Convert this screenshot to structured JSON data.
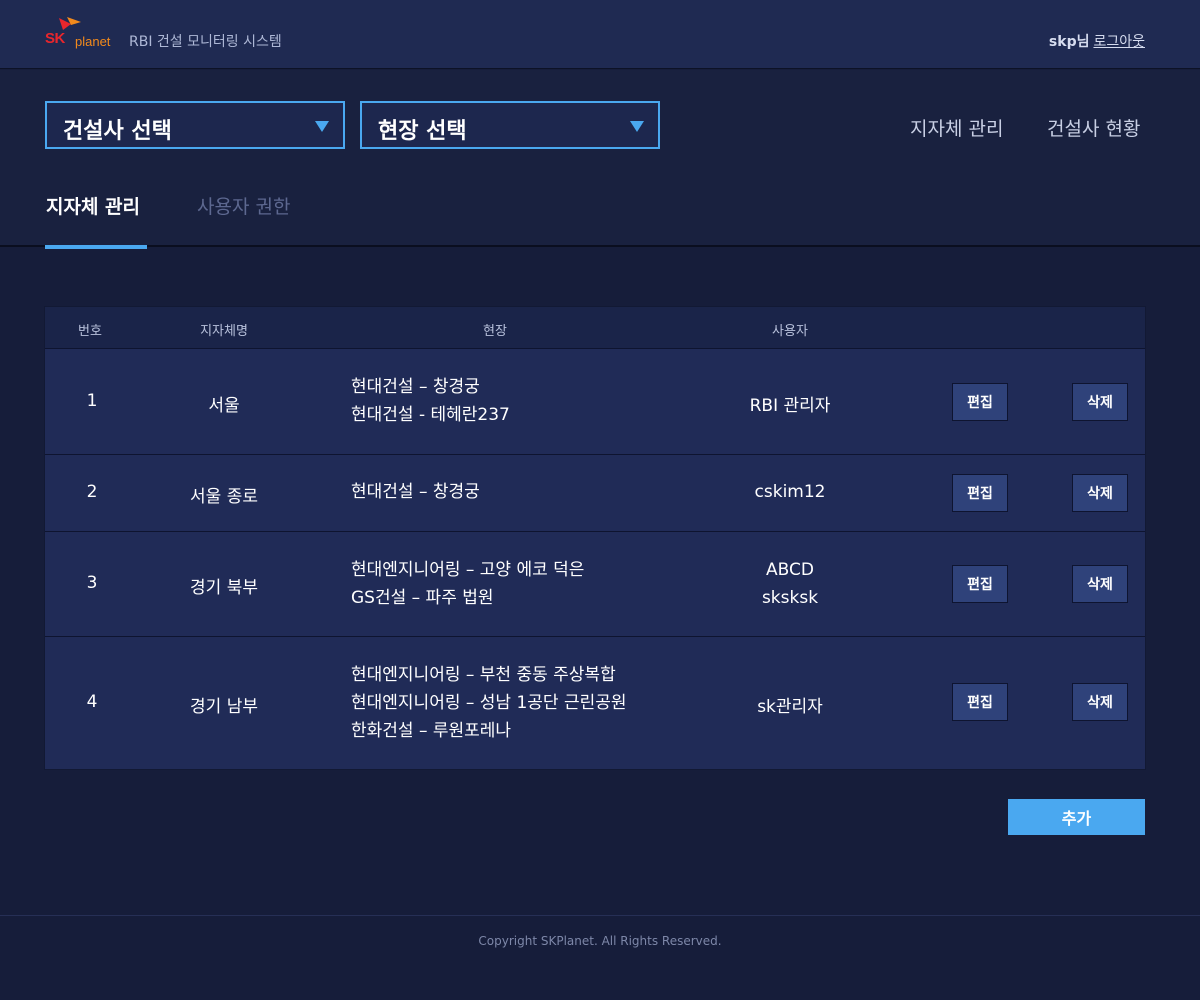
{
  "header": {
    "logo_sk": "SK",
    "logo_planet": "planet",
    "app_title": "RBI 건설 모니터링 시스템",
    "user_name": "skp님",
    "logout_label": "로그아웃"
  },
  "selectors": {
    "company_label": "건설사 선택",
    "site_label": "현장 선택"
  },
  "topnav": {
    "items": [
      "지자체 관리",
      "건설사 현황"
    ]
  },
  "tabs": [
    {
      "label": "지자체 관리",
      "active": true
    },
    {
      "label": "사용자 권한",
      "active": false
    }
  ],
  "table": {
    "headers": [
      "번호",
      "지자체명",
      "현장",
      "사용자"
    ],
    "rows": [
      {
        "no": "1",
        "region": "서울",
        "sites": [
          "현대건설 – 창경궁",
          "현대건설 - 테헤란237"
        ],
        "users": [
          "RBI 관리자"
        ]
      },
      {
        "no": "2",
        "region": "서울 종로",
        "sites": [
          "현대건설 – 창경궁"
        ],
        "users": [
          "cskim12"
        ]
      },
      {
        "no": "3",
        "region": "경기 북부",
        "sites": [
          "현대엔지니어링 – 고양 에코 덕은",
          "GS건설 – 파주 법원"
        ],
        "users": [
          "ABCD",
          "sksksk"
        ]
      },
      {
        "no": "4",
        "region": "경기 남부",
        "sites": [
          "현대엔지니어링 – 부천 중동 주상복합",
          "현대엔지니어링 – 성남 1공단 근린공원",
          "한화건설 – 루원포레나"
        ],
        "users": [
          "sk관리자"
        ]
      }
    ],
    "edit_label": "편집",
    "delete_label": "삭제"
  },
  "add_label": "추가",
  "footer": {
    "copyright": "Copyright SKPlanet. All Rights Reserved."
  },
  "colors": {
    "accent": "#4aa8f0",
    "background": "#161d3a",
    "header": "#1f2a52",
    "table_body": "#202b57",
    "button": "#2f427a",
    "logo_red": "#e8262c",
    "logo_orange": "#f28a1c"
  }
}
